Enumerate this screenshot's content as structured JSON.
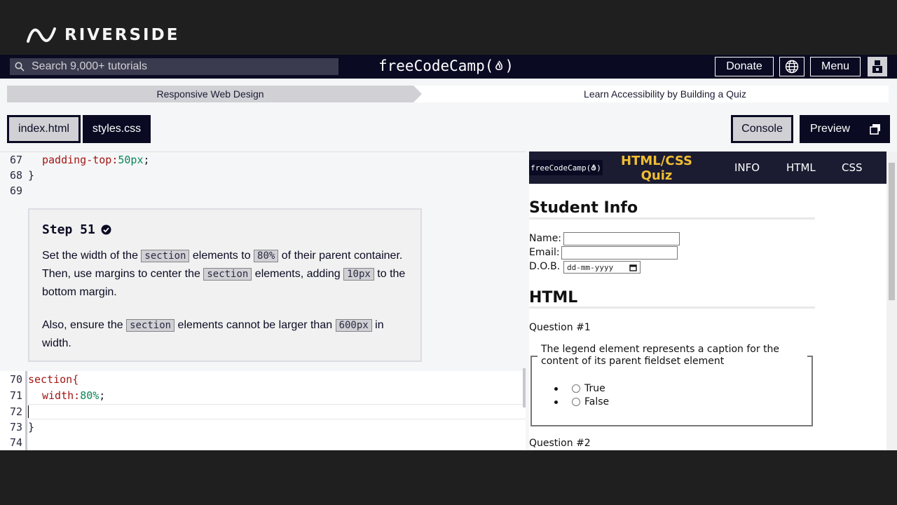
{
  "overlay": {
    "brand": "RIVERSIDE"
  },
  "nav": {
    "search_placeholder": "Search 9,000+ tutorials",
    "brand": "freeCodeCamp(",
    "brand_suffix": ")",
    "donate": "Donate",
    "menu": "Menu"
  },
  "breadcrumb": {
    "course": "Responsive Web Design",
    "project": "Learn Accessibility by Building a Quiz"
  },
  "tabs": {
    "index": "index.html",
    "styles": "styles.css"
  },
  "actions": {
    "console": "Console",
    "preview": "Preview"
  },
  "code_top": [
    {
      "num": "67",
      "prop": "padding-top",
      "colon": ": ",
      "value": "50px",
      "end": ";"
    },
    {
      "num": "68",
      "text": "}"
    },
    {
      "num": "69",
      "text": ""
    }
  ],
  "step": {
    "title": "Step 51",
    "p1_a": "Set the width of the ",
    "p1_code1": "section",
    "p1_b": " elements to ",
    "p1_code2": "80%",
    "p1_c": " of their parent container. Then, use margins to center the ",
    "p1_code3": "section",
    "p1_d": " elements, adding ",
    "p1_code4": "10px",
    "p1_e": " to the bottom margin.",
    "p2_a": "Also, ensure the ",
    "p2_code1": "section",
    "p2_b": " elements cannot be larger than ",
    "p2_code2": "600px",
    "p2_c": " in width."
  },
  "code_bottom": {
    "l70_num": "70",
    "l70_text": "section{",
    "l71_num": "71",
    "l71_prop": "width",
    "l71_colon": ": ",
    "l71_value": "80%",
    "l71_end": ";",
    "l72_num": "72",
    "l73_num": "73",
    "l73_text": "}",
    "l74_num": "74"
  },
  "preview": {
    "logo": "freeCodeCamp(",
    "logo_suffix": ")",
    "title": "HTML/CSS Quiz",
    "links": [
      "INFO",
      "HTML",
      "CSS"
    ],
    "student_info": "Student Info",
    "name_label": "Name:",
    "email_label": "Email:",
    "dob_label": "D.O.B.",
    "dob_placeholder": "dd-mm-yyyy",
    "html_heading": "HTML",
    "q1": "Question #1",
    "q1_legend": "The legend element represents a caption for the content of its parent fieldset element",
    "opt_true": "True",
    "opt_false": "False",
    "q2": "Question #2"
  },
  "colors": {
    "nav_bg": "#0a0a23",
    "quiz_title": "#f1be32",
    "css_property": "#a31515",
    "css_value": "#098658"
  }
}
